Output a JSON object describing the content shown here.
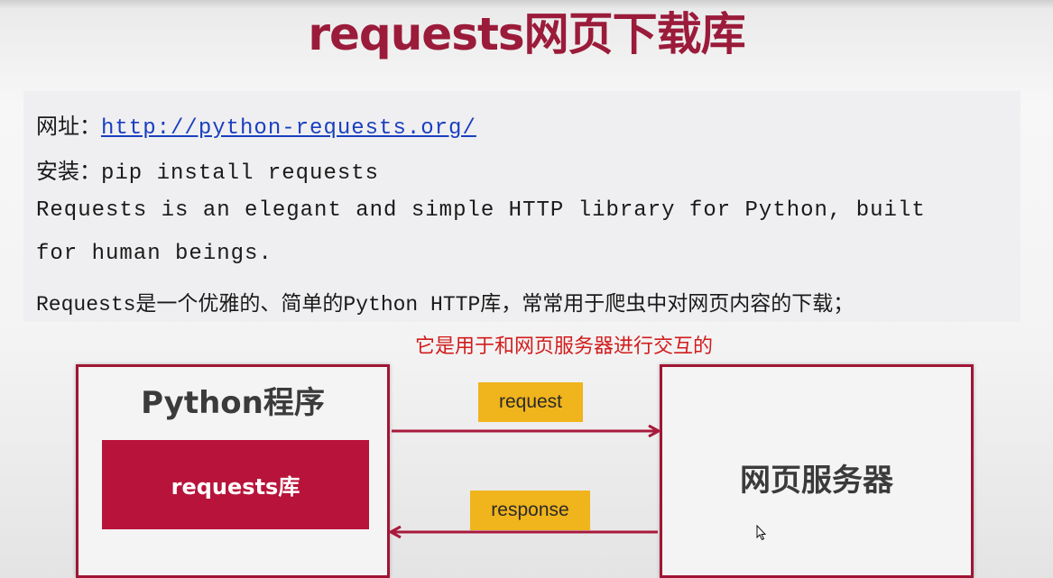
{
  "colors": {
    "title": "#9b1b3a",
    "link": "#1a3fbf",
    "note": "#d21c1c",
    "frame": "#a01534",
    "requests_lib_bg": "#b8133b",
    "tag_bg": "#f0b41c",
    "arrow": "#a81a3c"
  },
  "slide": {
    "title": "requests网页下载库"
  },
  "info": {
    "url_label": "网址：",
    "url": "http://python-requests.org/",
    "install_label": "安装：",
    "install_cmd": "pip install requests",
    "desc_en_line1": "Requests is an elegant and simple HTTP library for Python, built",
    "desc_en_line2": "for human beings.",
    "desc_cn": "Requests是一个优雅的、简单的Python HTTP库，常常用于爬虫中对网页内容的下载；"
  },
  "diagram": {
    "note": "它是用于和网页服务器进行交互的",
    "left_box_title": "Python程序",
    "inner_label": "requests库",
    "right_box_label": "网页服务器",
    "request_label": "request",
    "response_label": "response"
  },
  "icons": {
    "cursor": "mouse-pointer-icon"
  }
}
